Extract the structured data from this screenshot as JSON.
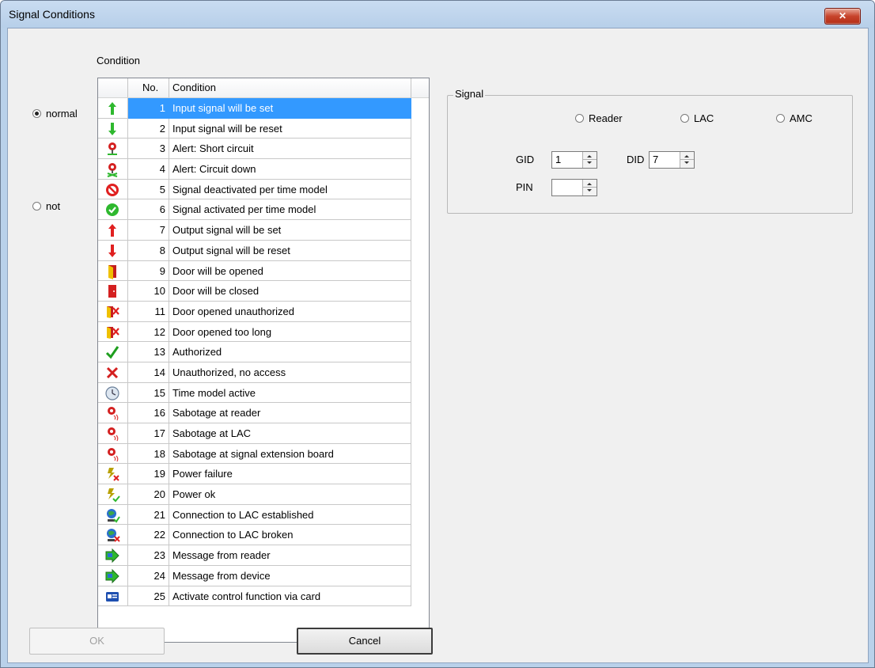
{
  "window": {
    "title": "Signal Conditions",
    "close_glyph": "✕"
  },
  "condition_label": "Condition",
  "modes": [
    {
      "label": "normal",
      "checked": true
    },
    {
      "label": "not",
      "checked": false
    }
  ],
  "table": {
    "headers": [
      "",
      "No.",
      "Condition"
    ],
    "rows": [
      {
        "no": "1",
        "text": "Input signal will be set",
        "icon": "input-set-icon",
        "selected": true
      },
      {
        "no": "2",
        "text": "Input signal will be reset",
        "icon": "input-reset-icon"
      },
      {
        "no": "3",
        "text": "Alert: Short circuit",
        "icon": "alert-short-icon"
      },
      {
        "no": "4",
        "text": "Alert: Circuit down",
        "icon": "alert-down-icon"
      },
      {
        "no": "5",
        "text": "Signal deactivated per time model",
        "icon": "deactivated-icon"
      },
      {
        "no": "6",
        "text": "Signal activated per time model",
        "icon": "activated-icon"
      },
      {
        "no": "7",
        "text": "Output signal will be set",
        "icon": "output-set-icon"
      },
      {
        "no": "8",
        "text": "Output signal will be reset",
        "icon": "output-reset-icon"
      },
      {
        "no": "9",
        "text": "Door will be opened",
        "icon": "door-open-icon"
      },
      {
        "no": "10",
        "text": "Door will be closed",
        "icon": "door-closed-icon"
      },
      {
        "no": "11",
        "text": "Door opened unauthorized",
        "icon": "door-unauthorized-icon"
      },
      {
        "no": "12",
        "text": "Door opened too long",
        "icon": "door-too-long-icon"
      },
      {
        "no": "13",
        "text": "Authorized",
        "icon": "check-icon"
      },
      {
        "no": "14",
        "text": "Unauthorized, no access",
        "icon": "cross-icon"
      },
      {
        "no": "15",
        "text": "Time model active",
        "icon": "clock-icon"
      },
      {
        "no": "16",
        "text": "Sabotage at reader",
        "icon": "sabotage-icon"
      },
      {
        "no": "17",
        "text": "Sabotage at LAC",
        "icon": "sabotage-icon"
      },
      {
        "no": "18",
        "text": "Sabotage at signal extension board",
        "icon": "sabotage-icon"
      },
      {
        "no": "19",
        "text": "Power failure",
        "icon": "power-failure-icon"
      },
      {
        "no": "20",
        "text": "Power ok",
        "icon": "power-ok-icon"
      },
      {
        "no": "21",
        "text": "Connection to LAC established",
        "icon": "connection-ok-icon"
      },
      {
        "no": "22",
        "text": "Connection to LAC broken",
        "icon": "connection-broken-icon"
      },
      {
        "no": "23",
        "text": "Message from reader",
        "icon": "message-icon"
      },
      {
        "no": "24",
        "text": "Message from device",
        "icon": "message-icon"
      },
      {
        "no": "25",
        "text": "Activate control function via card",
        "icon": "card-icon"
      }
    ]
  },
  "signal": {
    "title": "Signal",
    "sources": [
      {
        "label": "Reader",
        "checked": false
      },
      {
        "label": "LAC",
        "checked": false
      },
      {
        "label": "AMC",
        "checked": false
      }
    ],
    "gid": {
      "label": "GID",
      "value": "1"
    },
    "did": {
      "label": "DID",
      "value": "7"
    },
    "pin": {
      "label": "PIN",
      "value": ""
    }
  },
  "buttons": {
    "ok": "OK",
    "cancel": "Cancel"
  },
  "colors": {
    "selection": "#3399ff",
    "title_bg": "#b9d1ea",
    "close": "#c7432b"
  }
}
